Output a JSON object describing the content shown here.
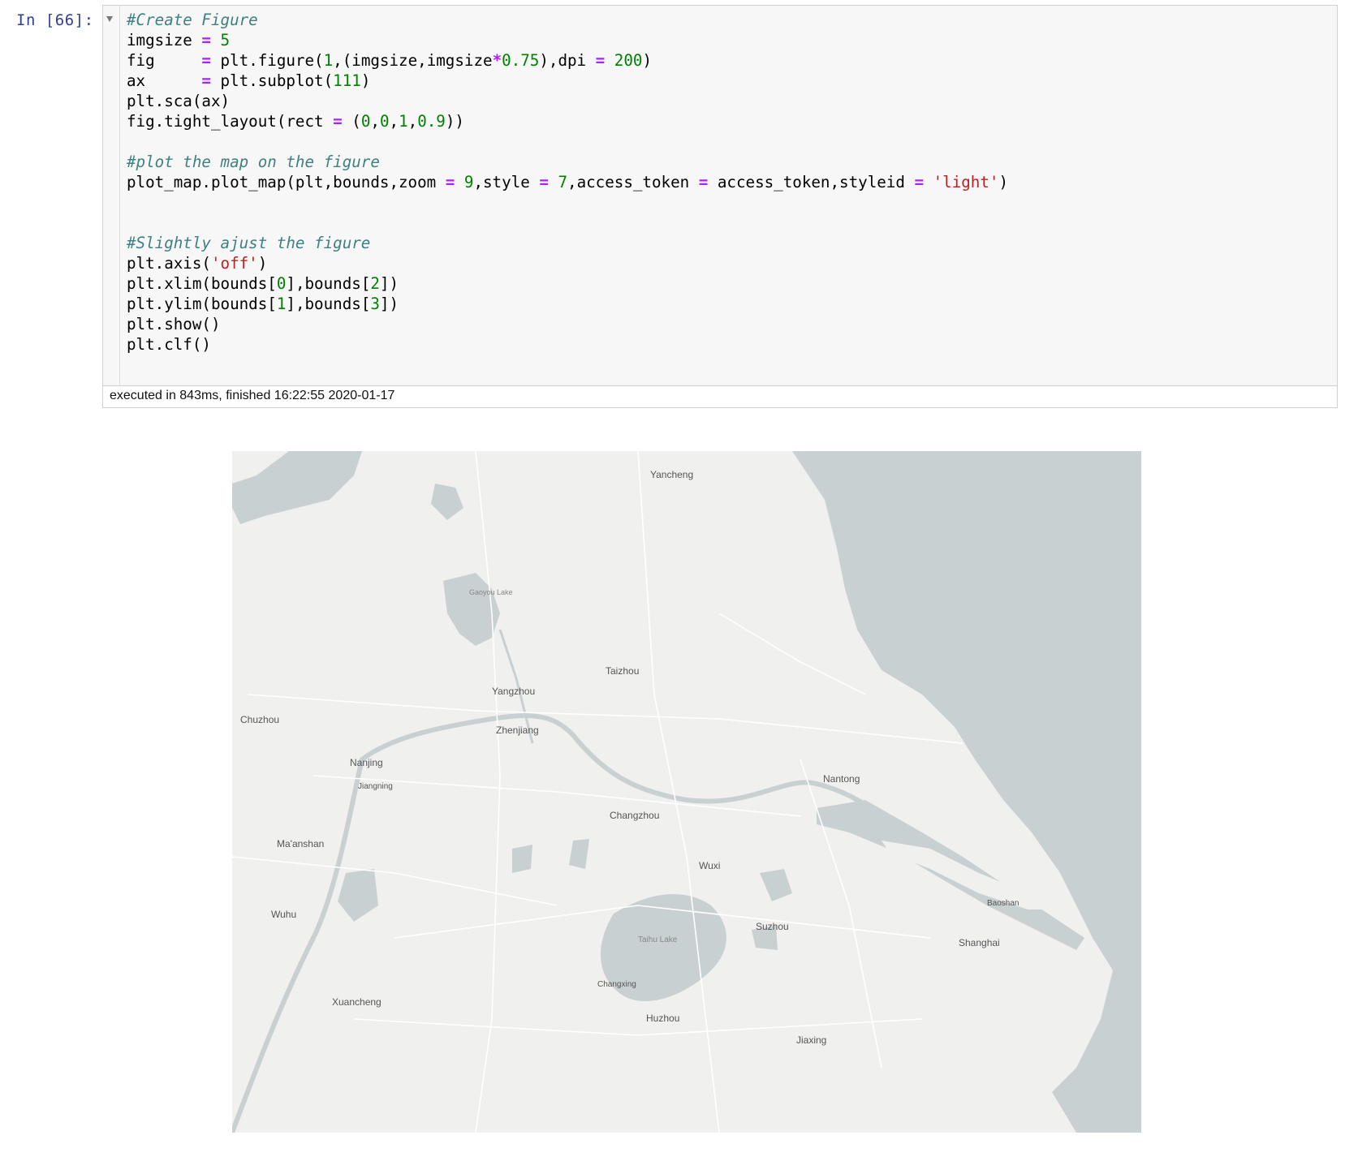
{
  "prompt": "In  [66]:",
  "code_lines": [
    {
      "tokens": [
        {
          "c": "cm",
          "t": "#Create Figure"
        }
      ]
    },
    {
      "tokens": [
        {
          "c": "",
          "t": "imgsize "
        },
        {
          "c": "op",
          "t": "="
        },
        {
          "c": "",
          "t": " "
        },
        {
          "c": "num",
          "t": "5"
        }
      ]
    },
    {
      "tokens": [
        {
          "c": "",
          "t": "fig     "
        },
        {
          "c": "op",
          "t": "="
        },
        {
          "c": "",
          "t": " plt.figure("
        },
        {
          "c": "num",
          "t": "1"
        },
        {
          "c": "",
          "t": ",(imgsize,imgsize"
        },
        {
          "c": "op",
          "t": "*"
        },
        {
          "c": "num",
          "t": "0.75"
        },
        {
          "c": "",
          "t": "),dpi "
        },
        {
          "c": "op",
          "t": "="
        },
        {
          "c": "",
          "t": " "
        },
        {
          "c": "num",
          "t": "200"
        },
        {
          "c": "",
          "t": ")"
        }
      ]
    },
    {
      "tokens": [
        {
          "c": "",
          "t": "ax      "
        },
        {
          "c": "op",
          "t": "="
        },
        {
          "c": "",
          "t": " plt.subplot("
        },
        {
          "c": "num",
          "t": "111"
        },
        {
          "c": "",
          "t": ")"
        }
      ]
    },
    {
      "tokens": [
        {
          "c": "",
          "t": "plt.sca(ax)"
        }
      ]
    },
    {
      "tokens": [
        {
          "c": "",
          "t": "fig.tight_layout(rect "
        },
        {
          "c": "op",
          "t": "="
        },
        {
          "c": "",
          "t": " ("
        },
        {
          "c": "num",
          "t": "0"
        },
        {
          "c": "",
          "t": ","
        },
        {
          "c": "num",
          "t": "0"
        },
        {
          "c": "",
          "t": ","
        },
        {
          "c": "num",
          "t": "1"
        },
        {
          "c": "",
          "t": ","
        },
        {
          "c": "num",
          "t": "0.9"
        },
        {
          "c": "",
          "t": "))"
        }
      ]
    },
    {
      "tokens": []
    },
    {
      "tokens": [
        {
          "c": "cm",
          "t": "#plot the map on the figure"
        }
      ]
    },
    {
      "tokens": [
        {
          "c": "",
          "t": "plot_map.plot_map(plt,bounds,zoom "
        },
        {
          "c": "op",
          "t": "="
        },
        {
          "c": "",
          "t": " "
        },
        {
          "c": "num",
          "t": "9"
        },
        {
          "c": "",
          "t": ",style "
        },
        {
          "c": "op",
          "t": "="
        },
        {
          "c": "",
          "t": " "
        },
        {
          "c": "num",
          "t": "7"
        },
        {
          "c": "",
          "t": ",access_token "
        },
        {
          "c": "op",
          "t": "="
        },
        {
          "c": "",
          "t": " access_token,styleid "
        },
        {
          "c": "op",
          "t": "="
        },
        {
          "c": "",
          "t": " "
        },
        {
          "c": "str",
          "t": "'light'"
        },
        {
          "c": "",
          "t": ")"
        }
      ]
    },
    {
      "tokens": []
    },
    {
      "tokens": []
    },
    {
      "tokens": [
        {
          "c": "cm",
          "t": "#Slightly ajust the figure"
        }
      ]
    },
    {
      "tokens": [
        {
          "c": "",
          "t": "plt.axis("
        },
        {
          "c": "str",
          "t": "'off'"
        },
        {
          "c": "",
          "t": ")"
        }
      ]
    },
    {
      "tokens": [
        {
          "c": "",
          "t": "plt.xlim(bounds["
        },
        {
          "c": "num",
          "t": "0"
        },
        {
          "c": "",
          "t": "],bounds["
        },
        {
          "c": "num",
          "t": "2"
        },
        {
          "c": "",
          "t": "])"
        }
      ]
    },
    {
      "tokens": [
        {
          "c": "",
          "t": "plt.ylim(bounds["
        },
        {
          "c": "num",
          "t": "1"
        },
        {
          "c": "",
          "t": "],bounds["
        },
        {
          "c": "num",
          "t": "3"
        },
        {
          "c": "",
          "t": "])"
        }
      ]
    },
    {
      "tokens": [
        {
          "c": "",
          "t": "plt.show()"
        }
      ]
    },
    {
      "tokens": [
        {
          "c": "",
          "t": "plt.clf()"
        }
      ]
    }
  ],
  "exec_info": "executed in 843ms, finished 16:22:55 2020-01-17",
  "map": {
    "colors": {
      "land": "#f0f0ef",
      "water": "#c9d0d2",
      "road": "#ffffff",
      "label": "#555555"
    },
    "labels": {
      "yancheng": "Yancheng",
      "taizhou": "Taizhou",
      "yangzhou": "Yangzhou",
      "zhenjiang": "Zhenjiang",
      "chuzhou": "Chuzhou",
      "nanjing": "Nanjing",
      "jiangning": "Jiangning",
      "nantong": "Nantong",
      "changzhou": "Changzhou",
      "maanshan": "Ma'anshan",
      "wuxi": "Wuxi",
      "wuhu": "Wuhu",
      "suzhou": "Suzhou",
      "shanghai": "Shanghai",
      "changxing": "Changxing",
      "xuancheng": "Xuancheng",
      "huzhou": "Huzhou",
      "jiaxing": "Jiaxing",
      "taihu": "Taihu Lake",
      "baoshan": "Baoshan",
      "gaoyou": "Gaoyou Lake"
    }
  }
}
